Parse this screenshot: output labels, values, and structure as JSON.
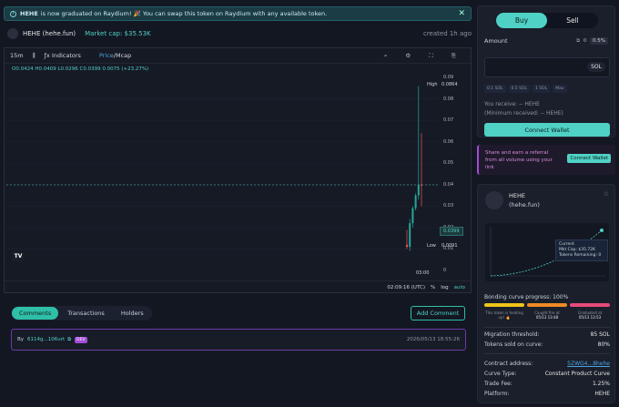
{
  "banner": {
    "token": "HEHE",
    "text": "is now graduated on Raydium! 🎉 You can swap this token on Raydium with any available token.",
    "close": "✕"
  },
  "token_header": {
    "name": "HEHE (hehe.fun)",
    "market_cap": "Market cap: $35.53K",
    "created": "created 1h ago"
  },
  "chart_toolbar": {
    "interval": "15m",
    "indicators": "Indicators",
    "price": "Price",
    "mcap": "/Mcap"
  },
  "ohlc": "O0.0424 H0.0409 L0.0296 C0.0399 0.0075 (+23.27%)",
  "chart_data": {
    "type": "candlestick",
    "y_ticks": [
      "0.09",
      "0.08",
      "0.07",
      "0.06",
      "0.05",
      "0.04",
      "0.03",
      "0.02",
      "0.01",
      "0"
    ],
    "ylim": [
      0,
      0.09
    ],
    "x_tick": "03:00",
    "high_label": "High",
    "high_value": "0.0864",
    "low_label": "Low",
    "low_value": "0.0091",
    "last_price": "0.0399",
    "candles": [
      {
        "o": 0.012,
        "h": 0.019,
        "l": 0.01,
        "c": 0.011
      },
      {
        "o": 0.011,
        "h": 0.024,
        "l": 0.009,
        "c": 0.022
      },
      {
        "o": 0.022,
        "h": 0.03,
        "l": 0.02,
        "c": 0.029
      },
      {
        "o": 0.029,
        "h": 0.036,
        "l": 0.028,
        "c": 0.035
      },
      {
        "o": 0.035,
        "h": 0.086,
        "l": 0.033,
        "c": 0.04
      },
      {
        "o": 0.04,
        "h": 0.064,
        "l": 0.03,
        "c": 0.0399
      }
    ]
  },
  "chart_bottom": {
    "time": "02:09:16 (UTC)",
    "pct": "%",
    "log": "log",
    "auto": "auto"
  },
  "tabs": [
    "Comments",
    "Transactions",
    "Holders"
  ],
  "add_comment": "Add Comment",
  "comment": {
    "by": "By",
    "address": "6114g...106urt",
    "badge": "DEV",
    "timestamp": "2026/05/13 18:55:26"
  },
  "trade": {
    "buy": "Buy",
    "sell": "Sell",
    "amount_label": "Amount",
    "slippage": "0.5%",
    "currency": "SOL",
    "quick": [
      "0.1 SOL",
      "0.5 SOL",
      "1 SOL",
      "Max"
    ],
    "receive": "You receive: -- HEHE",
    "min_receive": "(Minimum received: -- HEHE)",
    "connect": "Connect Wallet"
  },
  "referral": {
    "text": "Share and earn a referral from all volume using your link",
    "button": "Connect Wallet"
  },
  "info": {
    "name": "HEHE",
    "symbol": "(hehe.fun)",
    "tooltip_current": "Current",
    "tooltip_mcap": "Mkt Cap: $35.72K",
    "tooltip_remaining": "Tokens Remaining: 0",
    "bonding_progress": "Bonding curve progress: 100%",
    "milestones": [
      {
        "label": "This token is heating up! 🔥",
        "date": ""
      },
      {
        "label": "Caught fire at",
        "date": "05/13 13:48"
      },
      {
        "label": "Graduated at",
        "date": "05/13 13:53"
      }
    ],
    "migration_label": "Migration threshold:",
    "migration_value": "85 SOL",
    "sold_label": "Tokens sold on curve:",
    "sold_value": "80%",
    "contract_label": "Contract address:",
    "contract_value": "5ZWG4...8hehe",
    "curve_label": "Curve Type:",
    "curve_value": "Constant Product Curve",
    "fee_label": "Trade Fee:",
    "fee_value": "1.25%",
    "platform_label": "Platform:",
    "platform_value": "HEHE"
  },
  "colors": {
    "accent": "#4fd1c5",
    "up": "#26a69a",
    "down": "#ef5350",
    "dev_badge": "#a24cd6"
  }
}
